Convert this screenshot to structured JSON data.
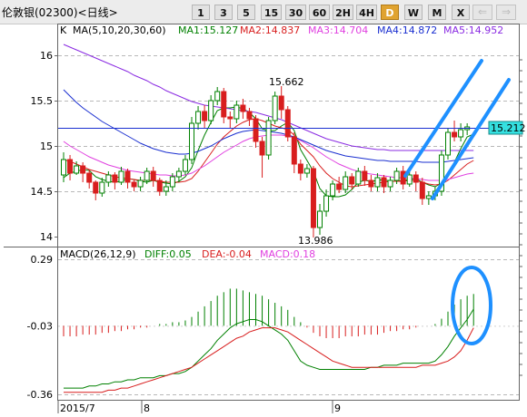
{
  "window": {
    "title": "伦敦银(02300)<日线>"
  },
  "periods": [
    {
      "label": "1",
      "active": false
    },
    {
      "label": "3",
      "active": false
    },
    {
      "label": "5",
      "active": false
    },
    {
      "label": "15",
      "active": false
    },
    {
      "label": "30",
      "active": false
    },
    {
      "label": "60",
      "active": false
    },
    {
      "label": "2H",
      "active": false
    },
    {
      "label": "4H",
      "active": false
    },
    {
      "label": "D",
      "active": true
    },
    {
      "label": "W",
      "active": false
    },
    {
      "label": "M",
      "active": false
    },
    {
      "label": "X",
      "active": false
    }
  ],
  "nav": {
    "prev_icon": "arrow-left-icon",
    "next_icon": "arrow-right-icon"
  },
  "price_panel": {
    "kind": "K",
    "ma_params": "MA(5,10,20,30,60)",
    "ma_legend": [
      {
        "label": "MA1:15.127",
        "color": "#008000"
      },
      {
        "label": "MA2:14.837",
        "color": "#d81e1e"
      },
      {
        "label": "MA3:14.704",
        "color": "#e040e0"
      },
      {
        "label": "MA4:14.872",
        "color": "#1a2fd0"
      },
      {
        "label": "MA5:14.952",
        "color": "#8a2be2"
      }
    ],
    "ticks": [
      "16",
      "15.5",
      "15",
      "14.5",
      "14"
    ],
    "high_label": "15.662",
    "low_label": "13.986",
    "current_price": "15.212"
  },
  "macd_panel": {
    "params": "MACD(26,12,9)",
    "diff_label": "DIFF:0.05",
    "dea_label": "DEA:-0.04",
    "macd_label": "MACD:0.18",
    "ticks": [
      "0.29",
      "-0.03",
      "-0.36"
    ]
  },
  "x_axis": {
    "labels": [
      "2015/7",
      "8",
      "9"
    ]
  },
  "chart_data": {
    "type": "candlestick",
    "y_range": [
      13.9,
      16.2
    ],
    "x_labels": [
      "2015/7",
      "8",
      "9"
    ],
    "candles": [
      [
        14.68,
        14.85,
        14.6,
        14.93
      ],
      [
        14.85,
        14.7,
        14.62,
        14.9
      ],
      [
        14.7,
        14.78,
        14.68,
        14.83
      ],
      [
        14.78,
        14.7,
        14.6,
        14.82
      ],
      [
        14.7,
        14.6,
        14.53,
        14.74
      ],
      [
        14.6,
        14.48,
        14.4,
        14.62
      ],
      [
        14.48,
        14.6,
        14.44,
        14.65
      ],
      [
        14.6,
        14.68,
        14.55,
        14.72
      ],
      [
        14.68,
        14.6,
        14.52,
        14.71
      ],
      [
        14.6,
        14.72,
        14.57,
        14.77
      ],
      [
        14.72,
        14.6,
        14.53,
        14.75
      ],
      [
        14.6,
        14.55,
        14.5,
        14.63
      ],
      [
        14.55,
        14.62,
        14.5,
        14.66
      ],
      [
        14.62,
        14.72,
        14.58,
        14.76
      ],
      [
        14.72,
        14.62,
        14.55,
        14.77
      ],
      [
        14.62,
        14.5,
        14.45,
        14.65
      ],
      [
        14.5,
        14.55,
        14.45,
        14.62
      ],
      [
        14.55,
        14.66,
        14.5,
        14.7
      ],
      [
        14.66,
        14.72,
        14.6,
        14.76
      ],
      [
        14.72,
        14.85,
        14.68,
        14.9
      ],
      [
        14.85,
        15.25,
        14.8,
        15.32
      ],
      [
        15.25,
        15.38,
        15.18,
        15.44
      ],
      [
        15.38,
        15.28,
        15.2,
        15.45
      ],
      [
        15.28,
        15.5,
        15.24,
        15.56
      ],
      [
        15.5,
        15.6,
        15.45,
        15.65
      ],
      [
        15.6,
        15.32,
        15.25,
        15.64
      ],
      [
        15.32,
        15.3,
        15.2,
        15.38
      ],
      [
        15.3,
        15.45,
        15.25,
        15.5
      ],
      [
        15.45,
        15.38,
        15.3,
        15.52
      ],
      [
        15.38,
        15.3,
        15.22,
        15.42
      ],
      [
        15.3,
        15.05,
        14.98,
        15.34
      ],
      [
        15.05,
        14.9,
        14.65,
        15.1
      ],
      [
        14.9,
        15.28,
        14.85,
        15.32
      ],
      [
        15.28,
        15.55,
        15.24,
        15.6
      ],
      [
        15.55,
        15.4,
        15.3,
        15.66
      ],
      [
        15.4,
        15.1,
        15.05,
        15.44
      ],
      [
        15.1,
        14.8,
        14.7,
        15.15
      ],
      [
        14.8,
        14.7,
        14.62,
        14.85
      ],
      [
        14.7,
        14.75,
        14.65,
        14.8
      ],
      [
        14.75,
        14.1,
        13.99,
        14.78
      ],
      [
        14.1,
        14.28,
        14.02,
        14.36
      ],
      [
        14.28,
        14.45,
        14.22,
        14.52
      ],
      [
        14.45,
        14.58,
        14.4,
        14.62
      ],
      [
        14.58,
        14.52,
        14.48,
        14.66
      ],
      [
        14.52,
        14.66,
        14.48,
        14.72
      ],
      [
        14.66,
        14.58,
        14.52,
        14.7
      ],
      [
        14.58,
        14.72,
        14.55,
        14.76
      ],
      [
        14.72,
        14.62,
        14.56,
        14.78
      ],
      [
        14.62,
        14.55,
        14.5,
        14.68
      ],
      [
        14.55,
        14.65,
        14.5,
        14.7
      ],
      [
        14.65,
        14.55,
        14.48,
        14.68
      ],
      [
        14.55,
        14.62,
        14.5,
        14.66
      ],
      [
        14.62,
        14.72,
        14.58,
        14.76
      ],
      [
        14.72,
        14.58,
        14.52,
        14.78
      ],
      [
        14.58,
        14.68,
        14.55,
        14.72
      ],
      [
        14.68,
        14.6,
        14.5,
        14.72
      ],
      [
        14.6,
        14.42,
        14.35,
        14.65
      ],
      [
        14.42,
        14.45,
        14.35,
        14.5
      ],
      [
        14.45,
        14.5,
        14.4,
        14.55
      ],
      [
        14.5,
        14.9,
        14.45,
        14.95
      ],
      [
        14.9,
        15.15,
        14.85,
        15.2
      ],
      [
        15.15,
        15.1,
        15.05,
        15.28
      ],
      [
        15.1,
        15.18,
        15.05,
        15.25
      ],
      [
        15.18,
        15.21,
        15.12,
        15.25
      ]
    ],
    "ma_series": {
      "MA1": [
        14.65,
        14.7,
        14.72,
        14.74,
        14.73,
        14.66,
        14.63,
        14.61,
        14.6,
        14.61,
        14.64,
        14.63,
        14.61,
        14.6,
        14.62,
        14.6,
        14.59,
        14.58,
        14.61,
        14.66,
        14.76,
        14.95,
        15.12,
        15.26,
        15.39,
        15.42,
        15.42,
        15.43,
        15.41,
        15.37,
        15.3,
        15.19,
        15.17,
        15.17,
        15.22,
        15.26,
        15.17,
        14.96,
        14.84,
        14.72,
        14.53,
        14.45,
        14.44,
        14.44,
        14.46,
        14.52,
        14.6,
        14.62,
        14.61,
        14.62,
        14.63,
        14.61,
        14.61,
        14.62,
        14.63,
        14.64,
        14.6,
        14.57,
        14.55,
        14.59,
        14.68,
        14.82,
        14.97,
        15.1,
        15.13
      ],
      "MA2": [
        14.85,
        14.83,
        14.8,
        14.77,
        14.74,
        14.72,
        14.7,
        14.68,
        14.66,
        14.65,
        14.64,
        14.63,
        14.62,
        14.62,
        14.62,
        14.61,
        14.6,
        14.6,
        14.6,
        14.61,
        14.64,
        14.72,
        14.82,
        14.92,
        15.02,
        15.1,
        15.16,
        15.22,
        15.26,
        15.29,
        15.3,
        15.28,
        15.25,
        15.22,
        15.2,
        15.18,
        15.12,
        15.02,
        14.95,
        14.88,
        14.78,
        14.7,
        14.64,
        14.6,
        14.56,
        14.55,
        14.56,
        14.57,
        14.58,
        14.59,
        14.6,
        14.61,
        14.61,
        14.61,
        14.62,
        14.62,
        14.6,
        14.58,
        14.57,
        14.58,
        14.62,
        14.68,
        14.74,
        14.8,
        14.84
      ],
      "MA3": [
        15.05,
        15.0,
        14.96,
        14.92,
        14.88,
        14.85,
        14.82,
        14.79,
        14.77,
        14.75,
        14.73,
        14.72,
        14.71,
        14.7,
        14.69,
        14.68,
        14.68,
        14.67,
        14.67,
        14.68,
        14.7,
        14.74,
        14.78,
        14.83,
        14.88,
        14.93,
        14.97,
        15.01,
        15.05,
        15.08,
        15.1,
        15.11,
        15.12,
        15.12,
        15.12,
        15.11,
        15.09,
        15.06,
        15.02,
        14.98,
        14.93,
        14.88,
        14.84,
        14.8,
        14.77,
        14.74,
        14.72,
        14.7,
        14.69,
        14.68,
        14.67,
        14.66,
        14.65,
        14.65,
        14.64,
        14.64,
        14.63,
        14.62,
        14.62,
        14.62,
        14.63,
        14.65,
        14.67,
        14.69,
        14.7
      ],
      "MA4": [
        15.62,
        15.55,
        15.48,
        15.42,
        15.37,
        15.32,
        15.27,
        15.23,
        15.19,
        15.15,
        15.11,
        15.07,
        15.03,
        15.0,
        14.97,
        14.95,
        14.93,
        14.92,
        14.91,
        14.91,
        14.92,
        14.94,
        14.97,
        15.0,
        15.04,
        15.08,
        15.11,
        15.14,
        15.16,
        15.17,
        15.18,
        15.17,
        15.16,
        15.15,
        15.14,
        15.12,
        15.1,
        15.07,
        15.04,
        15.01,
        14.98,
        14.95,
        14.93,
        14.91,
        14.89,
        14.88,
        14.87,
        14.86,
        14.85,
        14.84,
        14.84,
        14.83,
        14.83,
        14.83,
        14.83,
        14.83,
        14.82,
        14.82,
        14.82,
        14.82,
        14.83,
        14.84,
        14.85,
        14.86,
        14.87
      ],
      "MA5": [
        16.12,
        16.09,
        16.06,
        16.03,
        16.0,
        15.97,
        15.94,
        15.91,
        15.88,
        15.85,
        15.82,
        15.78,
        15.75,
        15.72,
        15.68,
        15.65,
        15.61,
        15.58,
        15.55,
        15.52,
        15.49,
        15.47,
        15.45,
        15.44,
        15.43,
        15.42,
        15.41,
        15.4,
        15.39,
        15.38,
        15.37,
        15.35,
        15.33,
        15.31,
        15.29,
        15.26,
        15.23,
        15.2,
        15.17,
        15.14,
        15.11,
        15.08,
        15.06,
        15.04,
        15.02,
        15.0,
        14.99,
        14.98,
        14.97,
        14.96,
        14.96,
        14.95,
        14.95,
        14.95,
        14.95,
        14.95,
        14.95,
        14.95,
        14.95,
        14.95,
        14.95,
        14.95,
        14.95,
        14.95,
        14.95
      ]
    },
    "macd_range": [
      -0.37,
      0.3
    ],
    "macd_hist": [
      -0.06,
      -0.06,
      -0.06,
      -0.05,
      -0.05,
      -0.05,
      -0.04,
      -0.04,
      -0.03,
      -0.03,
      -0.02,
      -0.02,
      -0.01,
      -0.01,
      0.0,
      0.01,
      0.01,
      0.02,
      0.02,
      0.03,
      0.05,
      0.08,
      0.11,
      0.14,
      0.17,
      0.19,
      0.21,
      0.21,
      0.2,
      0.19,
      0.18,
      0.17,
      0.15,
      0.13,
      0.11,
      0.09,
      0.05,
      0.02,
      -0.01,
      -0.04,
      -0.06,
      -0.07,
      -0.07,
      -0.07,
      -0.06,
      -0.06,
      -0.06,
      -0.05,
      -0.05,
      -0.05,
      -0.04,
      -0.03,
      -0.03,
      -0.02,
      -0.02,
      -0.01,
      0.0,
      0.0,
      0.01,
      0.04,
      0.08,
      0.12,
      0.15,
      0.17,
      0.18
    ],
    "diff_series": [
      -0.33,
      -0.33,
      -0.33,
      -0.33,
      -0.32,
      -0.32,
      -0.31,
      -0.31,
      -0.3,
      -0.3,
      -0.29,
      -0.29,
      -0.28,
      -0.28,
      -0.28,
      -0.27,
      -0.27,
      -0.26,
      -0.26,
      -0.25,
      -0.23,
      -0.2,
      -0.17,
      -0.14,
      -0.1,
      -0.07,
      -0.04,
      -0.02,
      -0.01,
      0.0,
      0.0,
      -0.01,
      -0.03,
      -0.05,
      -0.07,
      -0.1,
      -0.15,
      -0.2,
      -0.22,
      -0.23,
      -0.24,
      -0.24,
      -0.24,
      -0.24,
      -0.24,
      -0.24,
      -0.24,
      -0.24,
      -0.23,
      -0.23,
      -0.22,
      -0.22,
      -0.22,
      -0.21,
      -0.21,
      -0.21,
      -0.21,
      -0.21,
      -0.2,
      -0.17,
      -0.13,
      -0.08,
      -0.04,
      0.0,
      0.05
    ],
    "dea_series": [
      -0.35,
      -0.35,
      -0.35,
      -0.35,
      -0.35,
      -0.35,
      -0.35,
      -0.34,
      -0.34,
      -0.33,
      -0.33,
      -0.32,
      -0.31,
      -0.3,
      -0.29,
      -0.28,
      -0.27,
      -0.26,
      -0.25,
      -0.24,
      -0.23,
      -0.21,
      -0.19,
      -0.17,
      -0.15,
      -0.13,
      -0.11,
      -0.09,
      -0.08,
      -0.06,
      -0.05,
      -0.04,
      -0.04,
      -0.04,
      -0.05,
      -0.06,
      -0.08,
      -0.1,
      -0.12,
      -0.14,
      -0.16,
      -0.18,
      -0.2,
      -0.21,
      -0.22,
      -0.23,
      -0.23,
      -0.23,
      -0.23,
      -0.23,
      -0.23,
      -0.23,
      -0.23,
      -0.23,
      -0.23,
      -0.23,
      -0.22,
      -0.22,
      -0.22,
      -0.21,
      -0.2,
      -0.18,
      -0.15,
      -0.1,
      -0.04
    ]
  }
}
